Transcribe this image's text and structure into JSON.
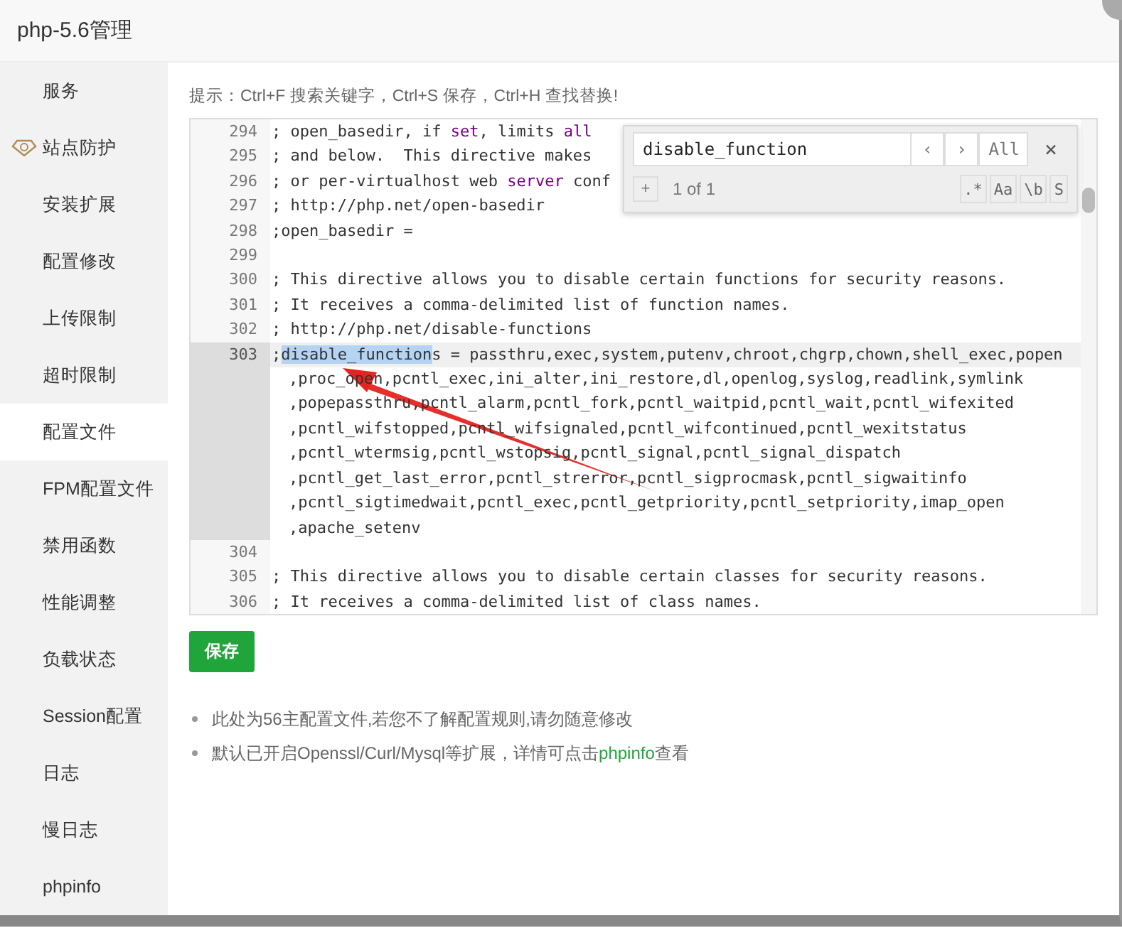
{
  "window": {
    "title": "php-5.6管理"
  },
  "sidebar": {
    "items": [
      {
        "label": "服务",
        "kind": "plain",
        "selected": false
      },
      {
        "label": "站点防护",
        "kind": "premium",
        "selected": false
      },
      {
        "label": "安装扩展",
        "kind": "plain",
        "selected": false
      },
      {
        "label": "配置修改",
        "kind": "plain",
        "selected": false
      },
      {
        "label": "上传限制",
        "kind": "plain",
        "selected": false
      },
      {
        "label": "超时限制",
        "kind": "plain",
        "selected": false
      },
      {
        "label": "配置文件",
        "kind": "plain",
        "selected": true
      },
      {
        "label": "FPM配置文件",
        "kind": "plain",
        "selected": false
      },
      {
        "label": "禁用函数",
        "kind": "plain",
        "selected": false
      },
      {
        "label": "性能调整",
        "kind": "plain",
        "selected": false
      },
      {
        "label": "负载状态",
        "kind": "plain",
        "selected": false
      },
      {
        "label": "Session配置",
        "kind": "plain",
        "selected": false
      },
      {
        "label": "日志",
        "kind": "plain",
        "selected": false
      },
      {
        "label": "慢日志",
        "kind": "plain",
        "selected": false
      },
      {
        "label": "phpinfo",
        "kind": "plain",
        "selected": false
      }
    ]
  },
  "hint": "提示：Ctrl+F 搜索关键字，Ctrl+S 保存，Ctrl+H 查找替换!",
  "editor": {
    "lines": [
      {
        "number": "294",
        "active": false,
        "parts": [
          {
            "text": "; open_basedir, if ",
            "kind": "plain"
          },
          {
            "text": "set",
            "kind": "keyword"
          },
          {
            "text": ", limits ",
            "kind": "plain"
          },
          {
            "text": "all",
            "kind": "keyword"
          }
        ]
      },
      {
        "number": "295",
        "active": false,
        "parts": [
          {
            "text": "; and below.  This directive makes",
            "kind": "plain"
          }
        ]
      },
      {
        "number": "296",
        "active": false,
        "parts": [
          {
            "text": "; or per-virtualhost web ",
            "kind": "plain"
          },
          {
            "text": "server",
            "kind": "keyword"
          },
          {
            "text": " conf",
            "kind": "plain"
          }
        ]
      },
      {
        "number": "297",
        "active": false,
        "parts": [
          {
            "text": "; http://php.net/open-basedir",
            "kind": "plain"
          }
        ]
      },
      {
        "number": "298",
        "active": false,
        "parts": [
          {
            "text": ";open_basedir =",
            "kind": "plain"
          }
        ]
      },
      {
        "number": "299",
        "active": false
      },
      {
        "number": "300",
        "active": false,
        "parts": [
          {
            "text": "; This directive allows you to disable certain functions for security reasons.",
            "kind": "plain"
          }
        ]
      },
      {
        "number": "301",
        "active": false,
        "parts": [
          {
            "text": "; It receives a comma-delimited list of function names.",
            "kind": "plain"
          }
        ]
      },
      {
        "number": "302",
        "active": false,
        "parts": [
          {
            "text": "; http://php.net/disable-functions",
            "kind": "plain"
          }
        ]
      },
      {
        "number": "303",
        "active": true,
        "parts": [
          {
            "text": ";",
            "kind": "plain"
          },
          {
            "text": "disable_function",
            "kind": "match"
          },
          {
            "text": "s = passthru,exec,system,putenv,chroot,chgrp,chown,shell_exec,popen",
            "kind": "plain"
          }
        ],
        "wrap": [
          ",proc_open,pcntl_exec,ini_alter,ini_restore,dl,openlog,syslog,readlink,symlink",
          ",popepassthru,pcntl_alarm,pcntl_fork,pcntl_waitpid,pcntl_wait,pcntl_wifexited",
          ",pcntl_wifstopped,pcntl_wifsignaled,pcntl_wifcontinued,pcntl_wexitstatus",
          ",pcntl_wtermsig,pcntl_wstopsig,pcntl_signal,pcntl_signal_dispatch",
          ",pcntl_get_last_error,pcntl_strerror,pcntl_sigprocmask,pcntl_sigwaitinfo",
          ",pcntl_sigtimedwait,pcntl_exec,pcntl_getpriority,pcntl_setpriority,imap_open",
          ",apache_setenv"
        ]
      },
      {
        "number": "304",
        "active": false
      },
      {
        "number": "305",
        "active": false,
        "parts": [
          {
            "text": "; This directive allows you to disable certain classes for security reasons.",
            "kind": "plain"
          }
        ]
      },
      {
        "number": "306",
        "active": false,
        "parts": [
          {
            "text": "; It receives a comma-delimited list of class names.",
            "kind": "plain"
          }
        ]
      }
    ]
  },
  "search": {
    "value": "disable_function",
    "prev": "‹",
    "next": "›",
    "all": "All",
    "close": "×",
    "add": "+",
    "count": "1 of 1",
    "flags": [
      ".*",
      "Aa",
      "\\b",
      "S"
    ]
  },
  "save_button": "保存",
  "notes": [
    {
      "text": "此处为56主配置文件,若您不了解配置规则,请勿随意修改"
    },
    {
      "text": "默认已开启Openssl/Curl/Mysql等扩展，详情可点击",
      "link": "phpinfo",
      "after": "查看"
    }
  ]
}
